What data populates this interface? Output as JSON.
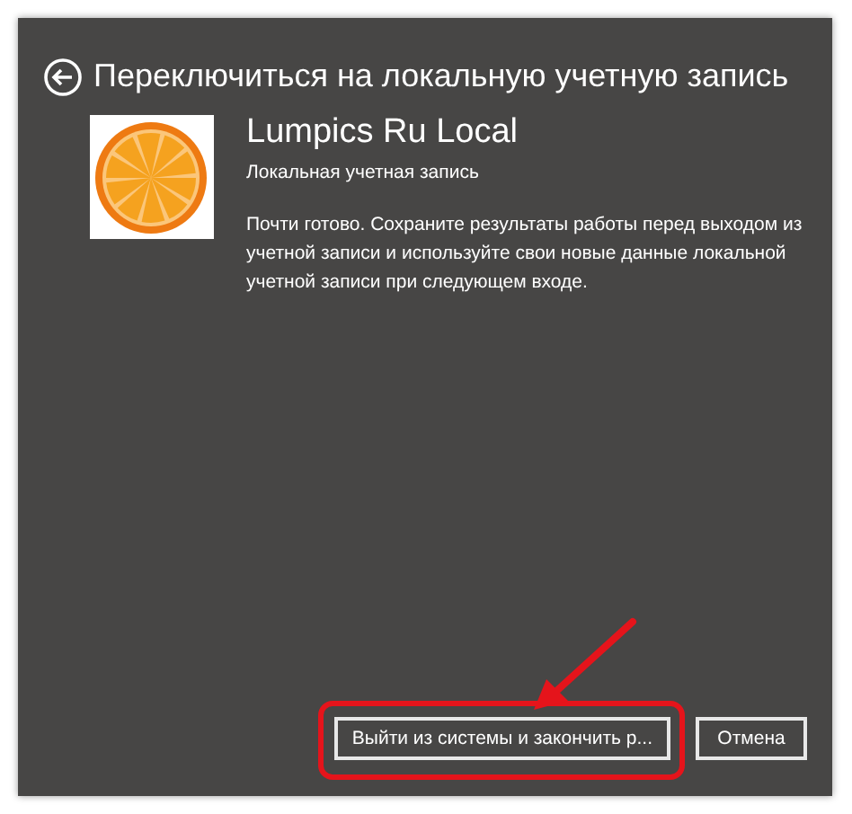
{
  "window": {
    "title": "Переключиться на локальную учетную запись"
  },
  "account": {
    "name": "Lumpics Ru Local",
    "type": "Локальная учетная запись"
  },
  "message": "Почти готово. Сохраните результаты работы перед выходом из учетной записи и используйте свои новые данные локальной учетной записи при следующем входе.",
  "buttons": [
    {
      "label": "Выйти из системы и закончить р...",
      "highlighted": true
    },
    {
      "label": "Отмена",
      "highlighted": false
    }
  ]
}
